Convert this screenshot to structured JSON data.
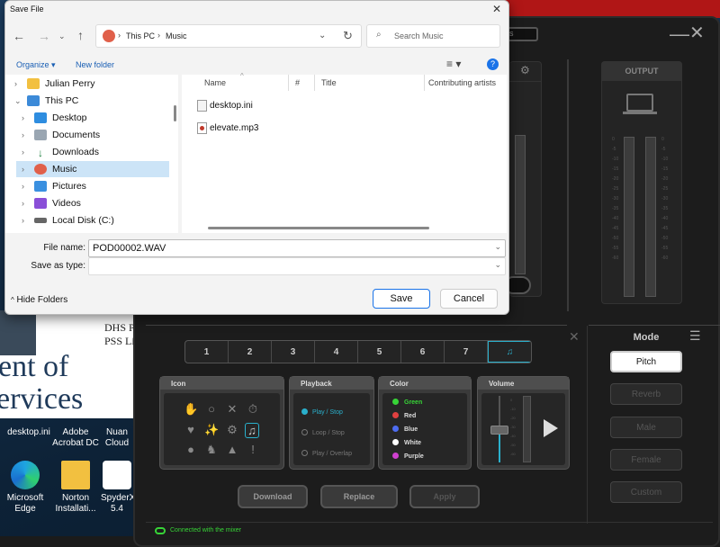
{
  "desktop": {
    "doc_text_1": "DHS P",
    "doc_text_2": "PSS Li",
    "doc_big_1": "ent of",
    "doc_big_2": "ervices",
    "icons": [
      {
        "label": "desktop.ini"
      },
      {
        "label": "Adobe Acrobat DC"
      },
      {
        "label": "Nuan Cloud"
      },
      {
        "label": "Microsoft Edge"
      },
      {
        "label": "Norton Installati..."
      },
      {
        "label": "SpyderX 5.4"
      }
    ]
  },
  "mixer": {
    "partial_button": "s",
    "output_label": "OUTPUT",
    "meter_scale": [
      "0",
      "-5",
      "-10",
      "-15",
      "-20",
      "-25",
      "-30",
      "-35",
      "-40",
      "-45",
      "-50",
      "-55",
      "-60"
    ],
    "tabs": [
      "1",
      "2",
      "3",
      "4",
      "5",
      "6",
      "7"
    ],
    "icon_card": {
      "title": "Icon"
    },
    "playback": {
      "title": "Playback",
      "options": [
        "Play / Stop",
        "Loop / Stop",
        "Play / Overlap"
      ],
      "selected": "Play / Stop"
    },
    "color": {
      "title": "Color",
      "options": [
        {
          "label": "Green",
          "hex": "#37d437"
        },
        {
          "label": "Red",
          "hex": "#e04040"
        },
        {
          "label": "Blue",
          "hex": "#4d6cf0"
        },
        {
          "label": "White",
          "hex": "#ffffff"
        },
        {
          "label": "Purple",
          "hex": "#d040d0"
        }
      ],
      "selected": "Green"
    },
    "volume": {
      "title": "Volume",
      "scale": [
        "0",
        "-10",
        "-20",
        "-30",
        "-40",
        "-50",
        "-60"
      ]
    },
    "mode": {
      "title": "Mode",
      "options": [
        "Pitch",
        "Reverb",
        "Male",
        "Female",
        "Custom"
      ],
      "selected": "Pitch"
    },
    "buttons": {
      "download": "Download",
      "replace": "Replace",
      "apply": "Apply"
    },
    "status": "Connected with the mixer",
    "accent": "#2ab0cc"
  },
  "dialog": {
    "title": "Save File",
    "breadcrumb": [
      "This PC",
      "Music"
    ],
    "search_placeholder": "Search Music",
    "organize": "Organize",
    "new_folder": "New folder",
    "nav_tree": [
      {
        "label": "Julian Perry",
        "icon": "folder-icon"
      },
      {
        "label": "This PC",
        "icon": "computer-icon"
      },
      {
        "label": "Desktop",
        "icon": "desktop-icon"
      },
      {
        "label": "Documents",
        "icon": "documents-icon"
      },
      {
        "label": "Downloads",
        "icon": "download-icon"
      },
      {
        "label": "Music",
        "icon": "music-icon"
      },
      {
        "label": "Pictures",
        "icon": "pictures-icon"
      },
      {
        "label": "Videos",
        "icon": "videos-icon"
      },
      {
        "label": "Local Disk (C:)",
        "icon": "disk-icon"
      }
    ],
    "columns": [
      "Name",
      "#",
      "Title",
      "Contributing artists"
    ],
    "files": [
      {
        "name": "desktop.ini",
        "icon": "settings-file-icon"
      },
      {
        "name": "elevate.mp3",
        "icon": "audio-file-icon"
      }
    ],
    "file_name_label": "File name:",
    "file_name_value": "POD00002.WAV",
    "save_as_label": "Save as type:",
    "save_as_value": "",
    "hide_folders": "Hide Folders",
    "save": "Save",
    "cancel": "Cancel"
  }
}
